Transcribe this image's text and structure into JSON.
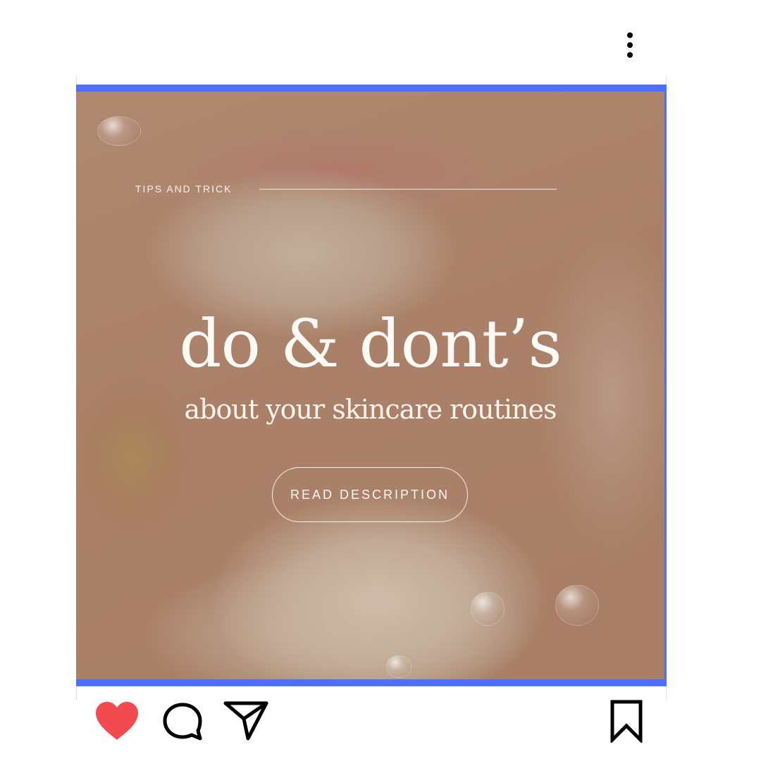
{
  "post": {
    "kicker": "TIPS AND TRICK",
    "title": "do & dont’s",
    "subtitle": "about your skincare routines",
    "cta_label": "READ DESCRIPTION"
  },
  "actions": [
    "like",
    "comment",
    "share",
    "save"
  ],
  "colors": {
    "like_active": "#f24a4f",
    "frame_accent": "#4f6ff8",
    "image_base": "#b98e74",
    "text_on_image": "#fffaf5"
  },
  "icons": [
    "more-options-icon",
    "heart-icon",
    "comment-icon",
    "share-icon",
    "bookmark-icon"
  ]
}
